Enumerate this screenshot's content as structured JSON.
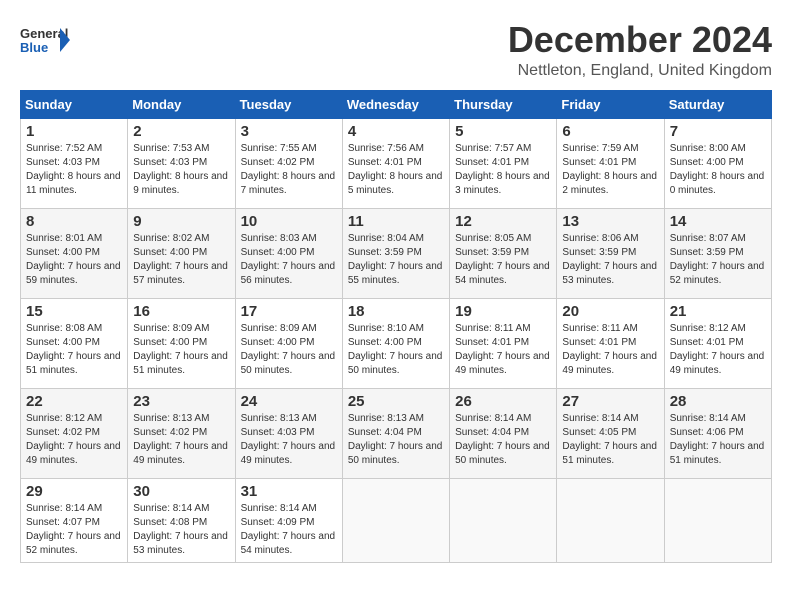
{
  "logo": {
    "text_general": "General",
    "text_blue": "Blue"
  },
  "header": {
    "title": "December 2024",
    "subtitle": "Nettleton, England, United Kingdom"
  },
  "weekdays": [
    "Sunday",
    "Monday",
    "Tuesday",
    "Wednesday",
    "Thursday",
    "Friday",
    "Saturday"
  ],
  "weeks": [
    [
      {
        "day": "1",
        "sunrise": "Sunrise: 7:52 AM",
        "sunset": "Sunset: 4:03 PM",
        "daylight": "Daylight: 8 hours and 11 minutes."
      },
      {
        "day": "2",
        "sunrise": "Sunrise: 7:53 AM",
        "sunset": "Sunset: 4:03 PM",
        "daylight": "Daylight: 8 hours and 9 minutes."
      },
      {
        "day": "3",
        "sunrise": "Sunrise: 7:55 AM",
        "sunset": "Sunset: 4:02 PM",
        "daylight": "Daylight: 8 hours and 7 minutes."
      },
      {
        "day": "4",
        "sunrise": "Sunrise: 7:56 AM",
        "sunset": "Sunset: 4:01 PM",
        "daylight": "Daylight: 8 hours and 5 minutes."
      },
      {
        "day": "5",
        "sunrise": "Sunrise: 7:57 AM",
        "sunset": "Sunset: 4:01 PM",
        "daylight": "Daylight: 8 hours and 3 minutes."
      },
      {
        "day": "6",
        "sunrise": "Sunrise: 7:59 AM",
        "sunset": "Sunset: 4:01 PM",
        "daylight": "Daylight: 8 hours and 2 minutes."
      },
      {
        "day": "7",
        "sunrise": "Sunrise: 8:00 AM",
        "sunset": "Sunset: 4:00 PM",
        "daylight": "Daylight: 8 hours and 0 minutes."
      }
    ],
    [
      {
        "day": "8",
        "sunrise": "Sunrise: 8:01 AM",
        "sunset": "Sunset: 4:00 PM",
        "daylight": "Daylight: 7 hours and 59 minutes."
      },
      {
        "day": "9",
        "sunrise": "Sunrise: 8:02 AM",
        "sunset": "Sunset: 4:00 PM",
        "daylight": "Daylight: 7 hours and 57 minutes."
      },
      {
        "day": "10",
        "sunrise": "Sunrise: 8:03 AM",
        "sunset": "Sunset: 4:00 PM",
        "daylight": "Daylight: 7 hours and 56 minutes."
      },
      {
        "day": "11",
        "sunrise": "Sunrise: 8:04 AM",
        "sunset": "Sunset: 3:59 PM",
        "daylight": "Daylight: 7 hours and 55 minutes."
      },
      {
        "day": "12",
        "sunrise": "Sunrise: 8:05 AM",
        "sunset": "Sunset: 3:59 PM",
        "daylight": "Daylight: 7 hours and 54 minutes."
      },
      {
        "day": "13",
        "sunrise": "Sunrise: 8:06 AM",
        "sunset": "Sunset: 3:59 PM",
        "daylight": "Daylight: 7 hours and 53 minutes."
      },
      {
        "day": "14",
        "sunrise": "Sunrise: 8:07 AM",
        "sunset": "Sunset: 3:59 PM",
        "daylight": "Daylight: 7 hours and 52 minutes."
      }
    ],
    [
      {
        "day": "15",
        "sunrise": "Sunrise: 8:08 AM",
        "sunset": "Sunset: 4:00 PM",
        "daylight": "Daylight: 7 hours and 51 minutes."
      },
      {
        "day": "16",
        "sunrise": "Sunrise: 8:09 AM",
        "sunset": "Sunset: 4:00 PM",
        "daylight": "Daylight: 7 hours and 51 minutes."
      },
      {
        "day": "17",
        "sunrise": "Sunrise: 8:09 AM",
        "sunset": "Sunset: 4:00 PM",
        "daylight": "Daylight: 7 hours and 50 minutes."
      },
      {
        "day": "18",
        "sunrise": "Sunrise: 8:10 AM",
        "sunset": "Sunset: 4:00 PM",
        "daylight": "Daylight: 7 hours and 50 minutes."
      },
      {
        "day": "19",
        "sunrise": "Sunrise: 8:11 AM",
        "sunset": "Sunset: 4:01 PM",
        "daylight": "Daylight: 7 hours and 49 minutes."
      },
      {
        "day": "20",
        "sunrise": "Sunrise: 8:11 AM",
        "sunset": "Sunset: 4:01 PM",
        "daylight": "Daylight: 7 hours and 49 minutes."
      },
      {
        "day": "21",
        "sunrise": "Sunrise: 8:12 AM",
        "sunset": "Sunset: 4:01 PM",
        "daylight": "Daylight: 7 hours and 49 minutes."
      }
    ],
    [
      {
        "day": "22",
        "sunrise": "Sunrise: 8:12 AM",
        "sunset": "Sunset: 4:02 PM",
        "daylight": "Daylight: 7 hours and 49 minutes."
      },
      {
        "day": "23",
        "sunrise": "Sunrise: 8:13 AM",
        "sunset": "Sunset: 4:02 PM",
        "daylight": "Daylight: 7 hours and 49 minutes."
      },
      {
        "day": "24",
        "sunrise": "Sunrise: 8:13 AM",
        "sunset": "Sunset: 4:03 PM",
        "daylight": "Daylight: 7 hours and 49 minutes."
      },
      {
        "day": "25",
        "sunrise": "Sunrise: 8:13 AM",
        "sunset": "Sunset: 4:04 PM",
        "daylight": "Daylight: 7 hours and 50 minutes."
      },
      {
        "day": "26",
        "sunrise": "Sunrise: 8:14 AM",
        "sunset": "Sunset: 4:04 PM",
        "daylight": "Daylight: 7 hours and 50 minutes."
      },
      {
        "day": "27",
        "sunrise": "Sunrise: 8:14 AM",
        "sunset": "Sunset: 4:05 PM",
        "daylight": "Daylight: 7 hours and 51 minutes."
      },
      {
        "day": "28",
        "sunrise": "Sunrise: 8:14 AM",
        "sunset": "Sunset: 4:06 PM",
        "daylight": "Daylight: 7 hours and 51 minutes."
      }
    ],
    [
      {
        "day": "29",
        "sunrise": "Sunrise: 8:14 AM",
        "sunset": "Sunset: 4:07 PM",
        "daylight": "Daylight: 7 hours and 52 minutes."
      },
      {
        "day": "30",
        "sunrise": "Sunrise: 8:14 AM",
        "sunset": "Sunset: 4:08 PM",
        "daylight": "Daylight: 7 hours and 53 minutes."
      },
      {
        "day": "31",
        "sunrise": "Sunrise: 8:14 AM",
        "sunset": "Sunset: 4:09 PM",
        "daylight": "Daylight: 7 hours and 54 minutes."
      },
      null,
      null,
      null,
      null
    ]
  ]
}
